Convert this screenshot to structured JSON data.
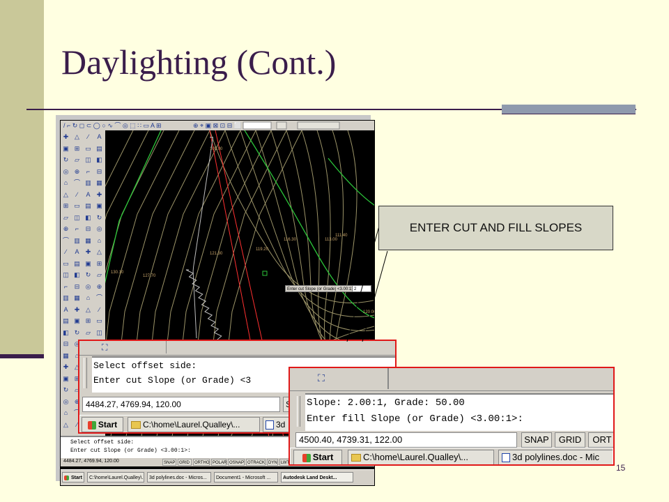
{
  "slide": {
    "title": "Daylighting (Cont.)",
    "callout": "ENTER CUT AND FILL SLOPES",
    "page_number": "15"
  },
  "drawing": {
    "contour_labels": [
      "130.10",
      "127.70",
      "121.30",
      "119.20",
      "116.30",
      "113.00",
      "111.40",
      "105.00",
      "120.00"
    ],
    "dynamic_prompt": "Enter cut Slope (or Grade) <3.00:1>:",
    "dynamic_input": "2",
    "colors": {
      "contour": "#9c9468",
      "green_contour": "#2cc63a",
      "red_line": "#ff3030",
      "hatch": "#bfbfbf",
      "label": "#c8a46a"
    }
  },
  "main_window": {
    "command_lines": [
      "Select offset side:",
      "Enter cut Slope (or Grade) <3.00:1>:"
    ],
    "coords": "4484.27, 4769.94, 120.00",
    "status_buttons": [
      "SNAP",
      "GRID",
      "ORTHO",
      "POLAR",
      "OSNAP",
      "OTRACK",
      "DYN",
      "LWT",
      "MODEL"
    ],
    "taskbar": [
      "Start",
      "C:\\home\\Laurel.Qualley\\...",
      "3d polylines.doc - Micros...",
      "Document1 - Microsoft ...",
      "Autodesk Land Deskt..."
    ]
  },
  "zoom1": {
    "command_lines": [
      "Select offset side:",
      "Enter cut Slope (or Grade) <3"
    ],
    "coords": "4484.27, 4769.94, 120.00",
    "status_first": "S",
    "taskbar": [
      "Start",
      "C:\\home\\Laurel.Qualley\\...",
      "3d"
    ]
  },
  "zoom2": {
    "command_lines": [
      "Slope: 2.00:1, Grade: 50.00",
      "Enter fill Slope (or Grade) <3.00:1>:"
    ],
    "coords": "4500.40, 4739.31, 122.00",
    "status_buttons": [
      "SNAP",
      "GRID",
      "ORT"
    ],
    "taskbar": [
      "Start",
      "C:\\home\\Laurel.Qualley\\...",
      "3d polylines.doc - Mic"
    ]
  }
}
